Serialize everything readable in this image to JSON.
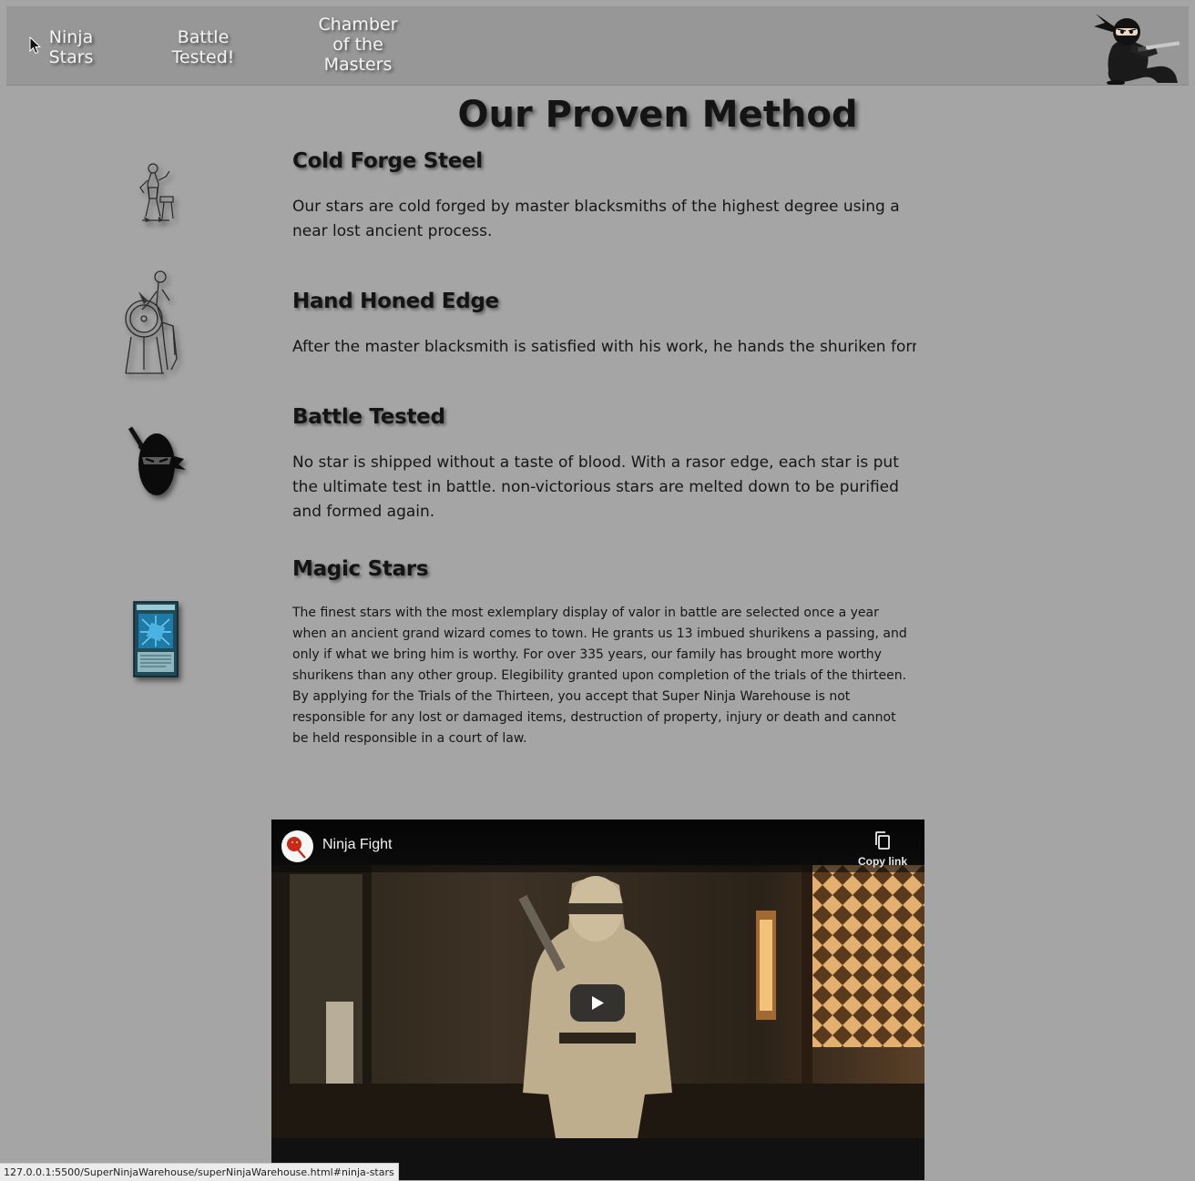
{
  "nav": {
    "links": [
      {
        "label": "Ninja\nStars"
      },
      {
        "label": "Battle\nTested!"
      },
      {
        "label": "Chamber\nof the\nMasters"
      }
    ]
  },
  "main": {
    "title": "Our Proven Method",
    "features": [
      {
        "icon": "blacksmith-icon",
        "heading": "Cold Forge Steel",
        "text": "Our stars are cold forged by master blacksmiths of the highest degree using a near lost ancient process."
      },
      {
        "icon": "grindstone-icon",
        "heading": "Hand Honed Edge",
        "text": "After the master blacksmith is satisfied with his work, he hands the shuriken form off to"
      },
      {
        "icon": "ninja-head-icon",
        "heading": "Battle Tested",
        "text": "No star is shipped without a taste of blood. With a rasor edge, each star is put the ultimate test in battle. non-victorious stars are melted down to be purified and formed again."
      },
      {
        "icon": "magic-card-icon",
        "heading": "Magic Stars",
        "text": "The finest stars with the most exlemplary display of valor in battle are selected once a year when an ancient grand wizard comes to town. He grants us 13 imbued shurikens a passing, and only if what we bring him is worthy. For over 335 years, our family has brought more worthy shurikens than any other group. Elegibility granted upon completion of the trials of the thirteen. By applying for the Trials of the Thirteen, you accept that Super Ninja Warehouse is not responsible for any lost or damaged items, destruction of property, injury or death and cannot be held responsible in a court of law."
      }
    ]
  },
  "video": {
    "title": "Ninja Fight",
    "copy_link_label": "Copy link"
  },
  "status": {
    "url": "127.0.0.1:5500/SuperNinjaWarehouse/superNinjaWarehouse.html#ninja-stars"
  },
  "colors": {
    "page_background": "#a5a5a5",
    "nav_background": "#979797",
    "video_background": "#0f0f0f"
  }
}
